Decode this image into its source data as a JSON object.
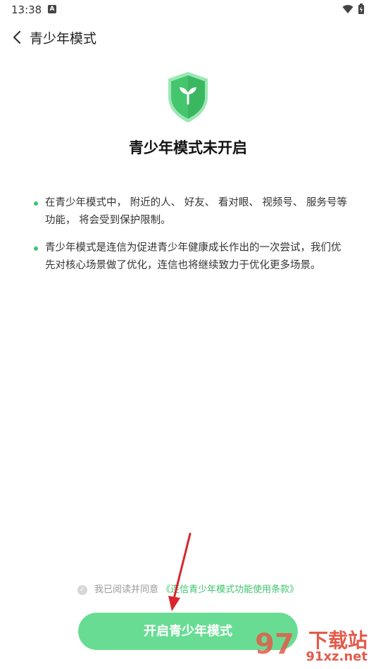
{
  "status_bar": {
    "time": "13:38",
    "notif_icon": "A"
  },
  "header": {
    "title": "青少年模式"
  },
  "main": {
    "headline": "青少年模式未开启",
    "bullets": [
      "在青少年模式中， 附近的人、 好友、 看对眼、 视频号、 服务号等功能， 将会受到保护限制。",
      "青少年模式是连信为促进青少年健康成长作出的一次尝试，我们优先对核心场景做了优化，连信也将继续致力于优化更多场景。"
    ]
  },
  "agreement": {
    "prefix": "我已阅读并同意",
    "link": "《连信青少年模式功能使用条款》"
  },
  "button": {
    "label": "开启青少年模式"
  },
  "watermark": {
    "title": "下载站",
    "url": "91xz.net"
  },
  "colors": {
    "accent": "#3ec46d",
    "button": "#69dc94",
    "arrow": "#d9262e"
  }
}
